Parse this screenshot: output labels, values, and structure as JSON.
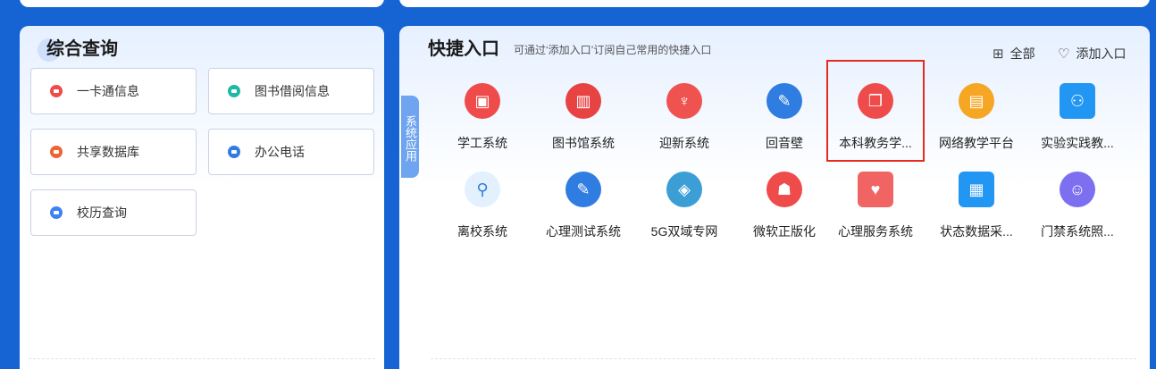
{
  "left_panel": {
    "title": "综合查询",
    "items": [
      {
        "label": "一卡通信息",
        "icon": "card-icon",
        "color": "#ef4b4b"
      },
      {
        "label": "图书借阅信息",
        "icon": "leaf-icon",
        "color": "#1fb8a6"
      },
      {
        "label": "共享数据库",
        "icon": "database-icon",
        "color": "#f06433"
      },
      {
        "label": "办公电话",
        "icon": "phone-icon",
        "color": "#2f7de1"
      },
      {
        "label": "校历查询",
        "icon": "calendar-book-icon",
        "color": "#3b82f6"
      }
    ]
  },
  "quick": {
    "title": "快捷入口",
    "subtitle": "可通过‘添加入口’订阅自己常用的快捷入口",
    "all_label": "全部",
    "add_label": "添加入口",
    "side_tab": "系统应用",
    "apps": [
      {
        "label": "学工系统",
        "icon": "student-affairs-icon",
        "color": "#ef4b4b"
      },
      {
        "label": "图书馆系统",
        "icon": "book-icon",
        "color": "#e84343"
      },
      {
        "label": "迎新系统",
        "icon": "graduation-cap-icon",
        "color": "#ef5350"
      },
      {
        "label": "回音壁",
        "icon": "edit-note-icon",
        "color": "#2f7de1"
      },
      {
        "label": "本科教务学...",
        "icon": "open-book-icon",
        "color": "#ef4b4b"
      },
      {
        "label": "网络教学平台",
        "icon": "online-teaching-icon",
        "color": "#f5a623"
      },
      {
        "label": "实验实践教...",
        "icon": "lab-practice-icon",
        "color": "#2196f3"
      },
      {
        "label": "离校系统",
        "icon": "leave-school-icon",
        "color": "#e3f0fd"
      },
      {
        "label": "心理测试系统",
        "icon": "psych-test-icon",
        "color": "#2f7de1"
      },
      {
        "label": "5G双域专网",
        "icon": "network-5g-icon",
        "color": "#3b9fd6"
      },
      {
        "label": "微软正版化",
        "icon": "people-icon",
        "color": "#ef4b4b"
      },
      {
        "label": "心理服务系统",
        "icon": "handshake-heart-icon",
        "color": "#f06464"
      },
      {
        "label": "状态数据采...",
        "icon": "clipboard-icon",
        "color": "#2196f3"
      },
      {
        "label": "门禁系统照...",
        "icon": "user-card-icon",
        "color": "#7c6ff0"
      }
    ]
  }
}
